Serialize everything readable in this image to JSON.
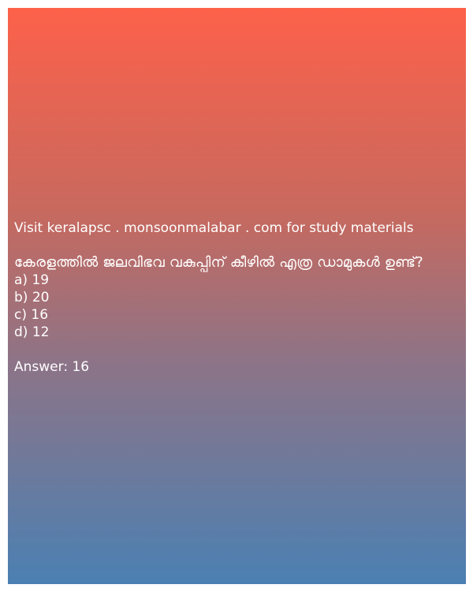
{
  "visit_text": "Visit keralapsc . monsoonmalabar . com for study materials",
  "question": " കേരളത്തിൽ ജലവിഭവ വകുപ്പിന് കീഴിൽ എത്ര ഡാമുകൾ ഉണ്ട്?",
  "options": {
    "a": "a) 19",
    "b": "b) 20",
    "c": "c) 16",
    "d": "d) 12"
  },
  "answer": "Answer: 16",
  "colors": {
    "gradient_top": "#fd614a",
    "gradient_bottom": "#4b80b2",
    "text": "#ffffff"
  }
}
